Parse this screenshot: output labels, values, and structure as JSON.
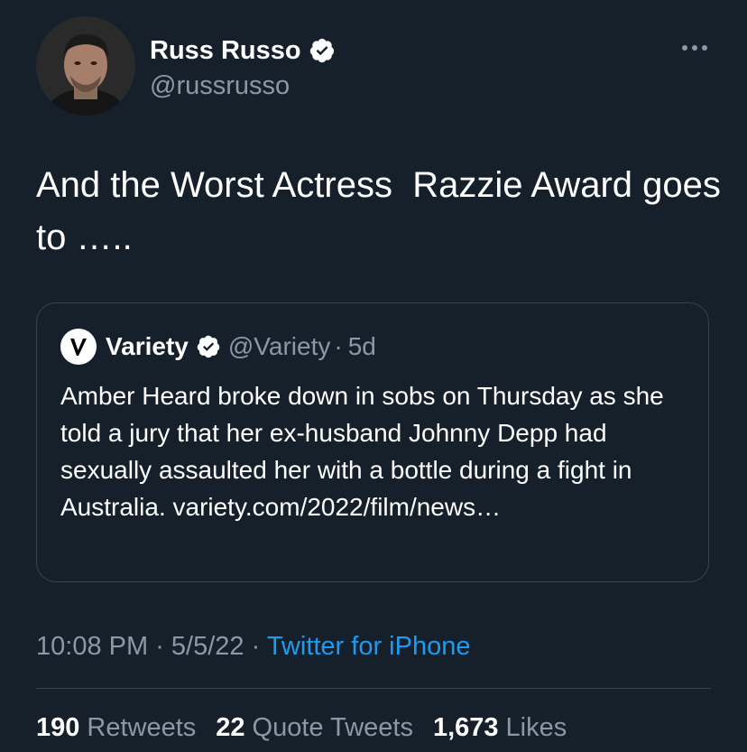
{
  "author": {
    "display_name": "Russ Russo",
    "handle": "@russrusso",
    "verified_icon": "verified-badge-icon",
    "avatar_icon": "profile-photo"
  },
  "more_icon": "more-options-icon",
  "tweet": {
    "text": "And the Worst Actress  Razzie Award goes to ….."
  },
  "quoted": {
    "display_name": "Variety",
    "handle": "@Variety",
    "separator": "·",
    "time": "5d",
    "logo_letter": "V",
    "text": "Amber Heard broke down in sobs on Thursday as she told a jury that her ex-husband Johnny Depp had sexually assaulted her with a bottle during a fight in Australia. variety.com/2022/film/news…"
  },
  "meta": {
    "time": "10:08 PM",
    "sep1": " · ",
    "date": "5/5/22",
    "sep2": " · ",
    "source": "Twitter for iPhone"
  },
  "stats": [
    {
      "count": "190",
      "label": "Retweets"
    },
    {
      "count": "22",
      "label": "Quote Tweets"
    },
    {
      "count": "1,673",
      "label": "Likes"
    }
  ],
  "colors": {
    "background": "#15202b",
    "text_primary": "#ffffff",
    "text_secondary": "#8b98a5",
    "accent": "#1d9bf0",
    "border": "#38444d"
  }
}
